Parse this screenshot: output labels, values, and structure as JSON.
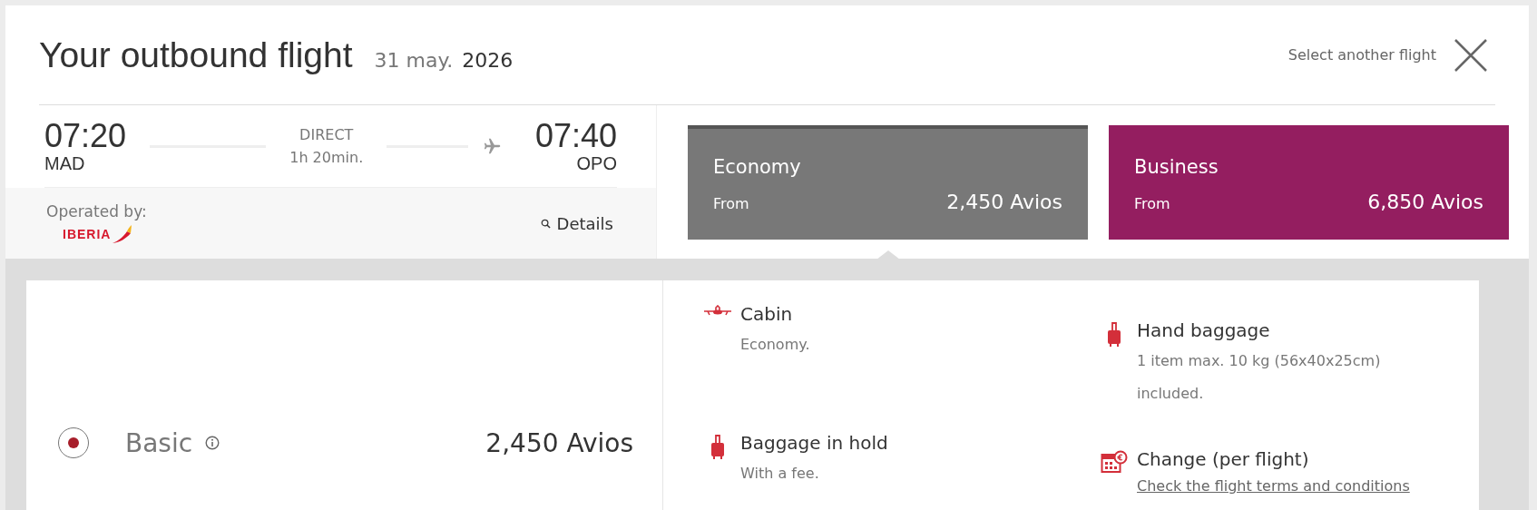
{
  "header": {
    "title": "Your outbound flight",
    "date": "31 may.",
    "year": "2026",
    "close_label": "Select another flight"
  },
  "flight": {
    "departure_time": "07:20",
    "departure_airport": "MAD",
    "type": "DIRECT",
    "duration": "1h 20min.",
    "arrival_time": "07:40",
    "arrival_airport": "OPO",
    "operated_label": "Operated by:",
    "airline": "IBERIA",
    "details": "Details"
  },
  "cabins": [
    {
      "name": "Economy",
      "from": "From",
      "price": "2,450 Avios",
      "color": "#787878",
      "selected": true
    },
    {
      "name": "Business",
      "from": "From",
      "price": "6,850 Avios",
      "color": "#941e60",
      "selected": false
    }
  ],
  "fare": {
    "name": "Basic",
    "price": "2,450 Avios",
    "selected": true
  },
  "features": [
    {
      "kind": "plane",
      "title": "Cabin",
      "details": [
        {
          "kind": "text",
          "text": "Economy."
        }
      ]
    },
    {
      "kind": "suitcase",
      "title": "Hand baggage",
      "details": [
        {
          "kind": "text",
          "text": "1 item max. 10 kg (56x40x25cm)"
        },
        {
          "kind": "text",
          "text": "included."
        }
      ]
    },
    {
      "kind": "suitcase",
      "title": "Baggage in hold",
      "details": [
        {
          "kind": "text",
          "text": "With a fee."
        }
      ]
    },
    {
      "kind": "calendar",
      "title": "Change (per flight)",
      "details": [
        {
          "kind": "link",
          "text": "Check the flight terms and conditions"
        }
      ]
    }
  ]
}
